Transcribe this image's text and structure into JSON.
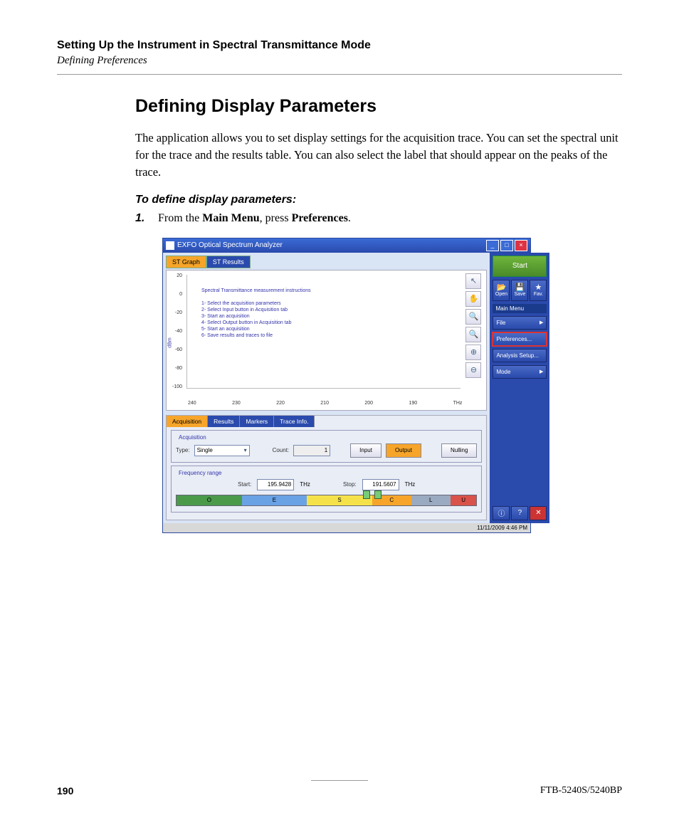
{
  "header": {
    "chapter": "Setting Up the Instrument in Spectral Transmittance Mode",
    "section": "Defining Preferences"
  },
  "title": "Defining Display Parameters",
  "paragraph": "The application allows you to set display settings for the acquisition trace. You can set the spectral unit for the trace and the results table. You can also select the label that should appear on the peaks of the trace.",
  "subhead": "To define display parameters:",
  "step1_num": "1.",
  "step1_a": "From the ",
  "step1_b": "Main Menu",
  "step1_c": ", press ",
  "step1_d": "Preferences",
  "step1_e": ".",
  "app": {
    "title": "EXFO Optical Spectrum Analyzer",
    "tabs": {
      "st_graph": "ST Graph",
      "st_results": "ST Results"
    },
    "graph": {
      "ylabel": "dBm",
      "yticks": [
        "20",
        "0",
        "-20",
        "-40",
        "-60",
        "-80",
        "-100"
      ],
      "xticks": [
        "240",
        "230",
        "220",
        "210",
        "200",
        "190"
      ],
      "xunit": "THz",
      "instr_title": "Spectral Transmittance measurement instructions",
      "instr": [
        "1- Select the acquisition parameters",
        "2- Select Input button in Acquisition tab",
        "3- Start an acquisition",
        "4- Select Output button in Acquisition tab",
        "5- Start an acquisition",
        "6- Save results and traces to file"
      ]
    },
    "bottom_tabs": {
      "acq": "Acquisition",
      "res": "Results",
      "mrk": "Markers",
      "trc": "Trace Info."
    },
    "acq": {
      "legend": "Acquisition",
      "type_label": "Type:",
      "type_value": "Single",
      "count_label": "Count:",
      "count_value": "1",
      "input": "Input",
      "output": "Output",
      "nulling": "Nulling"
    },
    "freq": {
      "legend": "Frequency range",
      "start_label": "Start:",
      "start_value": "195.9428",
      "start_unit": "THz",
      "stop_label": "Stop:",
      "stop_value": "191.5607",
      "stop_unit": "THz",
      "bands": {
        "o": "O",
        "e": "E",
        "s": "S",
        "c": "C",
        "l": "L",
        "u": "U"
      }
    },
    "side": {
      "start": "Start",
      "open": "Open",
      "save": "Save",
      "fav": "Fav.",
      "main_menu": "Main Menu",
      "file": "File",
      "prefs": "Preferences...",
      "analysis": "Analysis Setup...",
      "mode": "Mode"
    },
    "status": {
      "datetime": "11/11/2009 4:46 PM"
    }
  },
  "footer": {
    "page": "190",
    "model": "FTB-5240S/5240BP"
  }
}
